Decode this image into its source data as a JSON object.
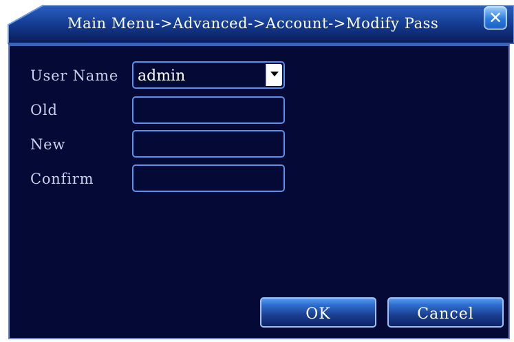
{
  "window": {
    "title": "Main Menu->Advanced->Account->Modify Pass",
    "close_icon": "close-icon"
  },
  "form": {
    "user_name_label": "User Name",
    "user_name_value": "admin",
    "old_label": "Old",
    "old_value": "",
    "new_label": "New",
    "new_value": "",
    "confirm_label": "Confirm",
    "confirm_value": ""
  },
  "buttons": {
    "ok_label": "OK",
    "cancel_label": "Cancel"
  },
  "colors": {
    "background": "#040a35",
    "accent": "#5f8fe6",
    "title_bar": "#0e2b7a"
  }
}
